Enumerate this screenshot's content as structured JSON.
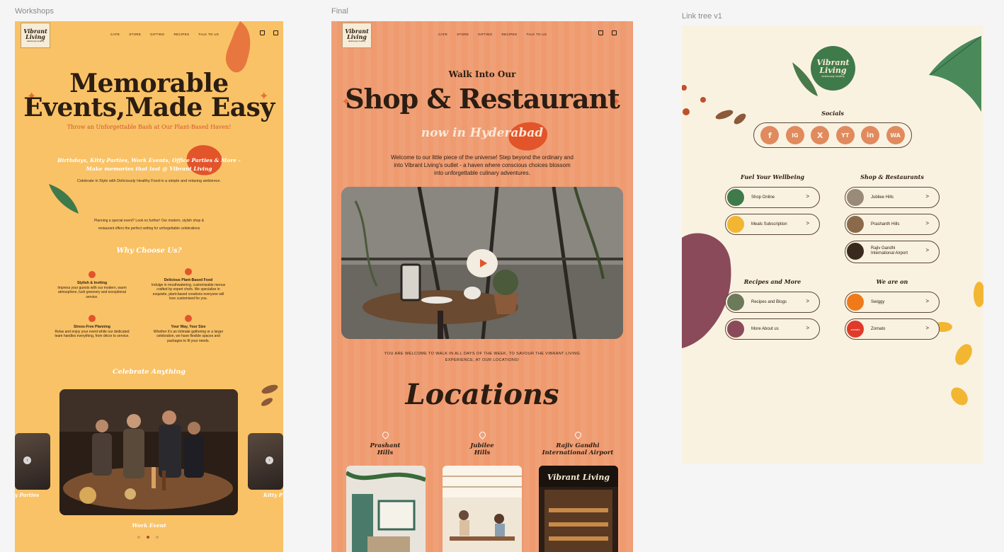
{
  "canvas_labels": {
    "workshops": "Workshops",
    "final": "Final",
    "linktree": "Link tree v1"
  },
  "brand": {
    "logo_line1": "Vibrant",
    "logo_line2": "Living",
    "tagline": "deliciously healthy"
  },
  "nav": {
    "items": [
      "CAFE",
      "STORE",
      "GIFTING",
      "RECIPES",
      "TALK TO US"
    ]
  },
  "workshops": {
    "headline_1": "Memorable",
    "headline_2": "Events,Made Easy",
    "subheadline": "Throw an Unforgettable Bash at Our Plant-Based Haven!",
    "occasions_1": "Birthdays, Kitty Parties, Work Events, Office Parties & More -",
    "occasions_2": "Make memories that last @ Vibrant Living",
    "celebrate": "Celebrate in Style with Deliciously Healthy Food in a simple and relaxing ambience.",
    "planning_1": "Planning a special event? Look no further! Our modern, stylish shop &",
    "planning_2": "restaurant offers the perfect setting for unforgettable celebrations",
    "why_title": "Why Choose Us?",
    "features": [
      {
        "title": "Stylish & Inviting",
        "body": "Impress your guests with our modern, warm atmosphere, lush greenery and exceptional service."
      },
      {
        "title": "Delicious Plant-Based Food",
        "body": "Indulge in mouthwatering, customizable menus crafted by expert chefs. We specialize in exquisite, plant-based creations everyone will love customised for you."
      },
      {
        "title": "Stress-Free Planning",
        "body": "Relax and enjoy your event while our dedicated team handles everything, from décor to service."
      },
      {
        "title": "Your Way, Your Size",
        "body": "Whether it's an intimate gathering or a larger celebration, we have flexible spaces and packages to fit your needs."
      }
    ],
    "celebrate_title": "Celebrate Anything",
    "carousel_caption": "Work Event",
    "side_left": "y Parties",
    "side_right": "Kitty P"
  },
  "final": {
    "kicker": "Walk Into Our",
    "headline": "Shop & Restaurant",
    "city": "now in Hyderabad",
    "intro_1": "Welcome to our little piece of the universe! Step beyond the ordinary and",
    "intro_2": "into Vibrant Living's outlet - a haven where conscious choices blossom",
    "intro_3": "into unforgettable culinary adventures.",
    "walk_in_1": "YOU ARE WELCOME TO WALK IN ALL DAYS OF THE WEEK, TO SAVOUR THE VIBRANT LIVING",
    "walk_in_2": "EXPERIENCE, AT OUR LOCATIONS!",
    "locations_title": "Locations",
    "locations": [
      {
        "l1": "Prashant",
        "l2": "Hills"
      },
      {
        "l1": "Jubilee",
        "l2": "Hills"
      },
      {
        "l1": "Rajiv Gandhi",
        "l2": "International Airport"
      }
    ],
    "store_sign": "Vibrant Living"
  },
  "linktree": {
    "socials_title": "Socials",
    "socials": [
      "f",
      "IG",
      "X",
      "YT",
      "in",
      "WA"
    ],
    "fuel_title": "Fuel Your Wellbeing",
    "shop_title": "Shop & Restaurants",
    "recipes_title": "Recipes and More",
    "weare_title": "We are on",
    "links": {
      "shop_online": "Shop Online",
      "meals": "Meals Subscription",
      "jubilee": "Jubliee Hills",
      "prashanth": "Prashanth Hills",
      "airport_1": "Rajiv Gandhi",
      "airport_2": "International Airport",
      "recipes": "Recipes and Blogs",
      "about": "More About us",
      "swiggy": "Swiggy",
      "zomato": "Zomato"
    },
    "zomato_badge": "zomato",
    "chevron": ">"
  },
  "colors": {
    "workshops_bg": "#f9c266",
    "final_bg": "#ef9a6f",
    "linktree_bg": "#faf2e1",
    "accent": "#e2542a",
    "brand_green": "#3f7a4a",
    "text_dark": "#2b1d12"
  }
}
